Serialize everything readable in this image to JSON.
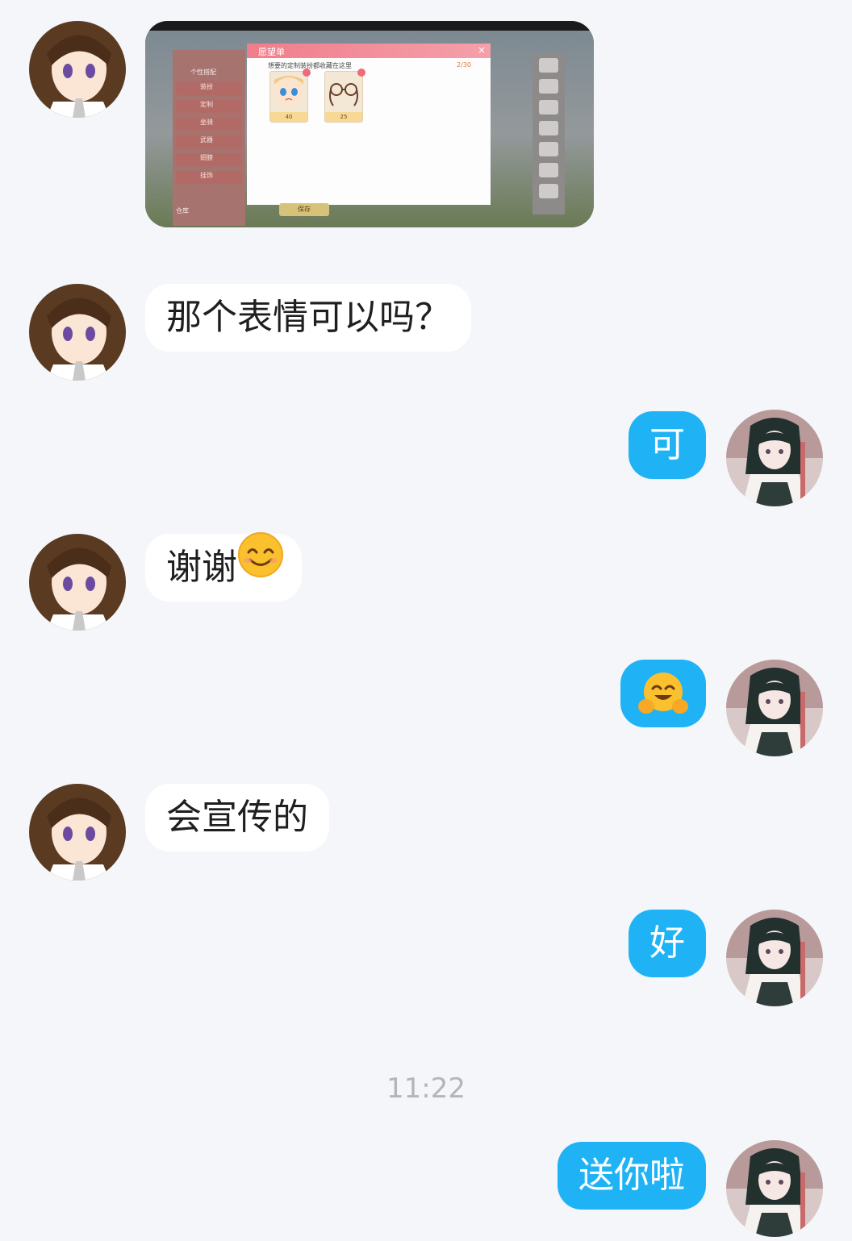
{
  "messages": [
    {
      "side": "left",
      "type": "image",
      "image": {
        "dialog_title": "愿望单",
        "dialog_subtitle": "想要的定制装扮都收藏在这里",
        "dialog_count": "2/30",
        "close_label": "×",
        "cards": [
          {
            "price": "40",
            "icon": "face-icon"
          },
          {
            "price": "25",
            "icon": "glasses-icon"
          }
        ],
        "save_label": "保存",
        "warehouse_label": "仓库",
        "menu": [
          "个性搭配",
          "装扮",
          "定制",
          "坐骑",
          "武器",
          "翅膀",
          "挂饰"
        ]
      }
    },
    {
      "side": "left",
      "type": "text",
      "text": "那个表情可以吗？"
    },
    {
      "side": "right",
      "type": "text",
      "text": "可"
    },
    {
      "side": "left",
      "type": "text",
      "text": "谢谢",
      "emoji": "smiling-face-icon"
    },
    {
      "side": "right",
      "type": "emoji",
      "emoji": "hugging-face-icon"
    },
    {
      "side": "left",
      "type": "text",
      "text": "会宣传的"
    },
    {
      "side": "right",
      "type": "text",
      "text": "好"
    },
    {
      "side": "right",
      "type": "text",
      "text": "送你啦"
    }
  ],
  "timestamp": "11:22",
  "colors": {
    "background": "#f4f6f9",
    "own_bubble": "#1fb3f6",
    "other_bubble": "#ffffff",
    "timestamp": "#b3b5b8"
  }
}
